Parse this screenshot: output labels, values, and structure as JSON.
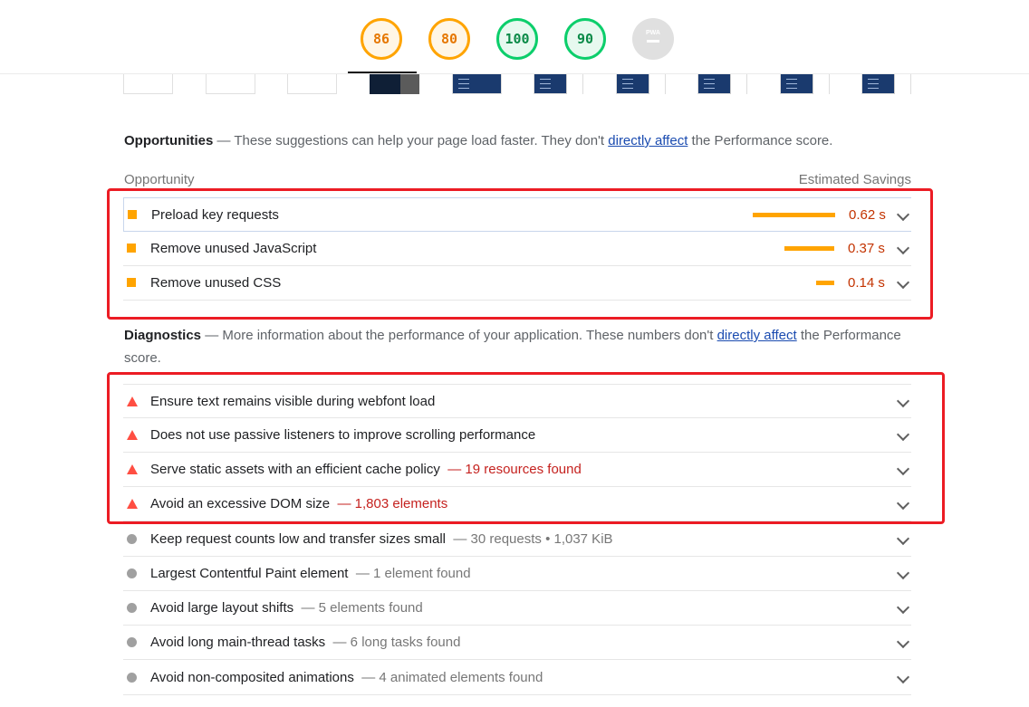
{
  "scores": [
    {
      "value": "86",
      "kind": "average"
    },
    {
      "value": "80",
      "kind": "average"
    },
    {
      "value": "100",
      "kind": "pass"
    },
    {
      "value": "90",
      "kind": "pass"
    }
  ],
  "pwa_label": "PWA",
  "opportunities": {
    "heading": "Opportunities",
    "desc_before": " — These suggestions can help your page load faster. They don't ",
    "link": "directly affect",
    "desc_after": " the Performance score.",
    "col_left": "Opportunity",
    "col_right": "Estimated Savings",
    "items": [
      {
        "title": "Preload key requests",
        "savings": "0.62 s",
        "fraction": 1.0
      },
      {
        "title": "Remove unused JavaScript",
        "savings": "0.37 s",
        "fraction": 0.6
      },
      {
        "title": "Remove unused CSS",
        "savings": "0.14 s",
        "fraction": 0.22
      }
    ]
  },
  "diagnostics": {
    "heading": "Diagnostics",
    "desc_before": " — More information about the performance of your application. These numbers don't ",
    "link": "directly affect",
    "desc_after": " the Performance score.",
    "items": [
      {
        "title": "Ensure text remains visible during webfont load",
        "display": "",
        "status": "fail"
      },
      {
        "title": "Does not use passive listeners to improve scrolling performance",
        "display": "",
        "status": "fail"
      },
      {
        "title": "Serve static assets with an efficient cache policy",
        "display": "— 19 resources found",
        "status": "fail"
      },
      {
        "title": "Avoid an excessive DOM size",
        "display": "— 1,803 elements",
        "status": "fail"
      },
      {
        "title": "Keep request counts low and transfer sizes small",
        "display": "— 30 requests • 1,037 KiB",
        "status": "info"
      },
      {
        "title": "Largest Contentful Paint element",
        "display": "— 1 element found",
        "status": "info"
      },
      {
        "title": "Avoid large layout shifts",
        "display": "— 5 elements found",
        "status": "info"
      },
      {
        "title": "Avoid long main-thread tasks",
        "display": "— 6 long tasks found",
        "status": "info"
      },
      {
        "title": "Avoid non-composited animations",
        "display": "— 4 animated elements found",
        "status": "info"
      }
    ]
  },
  "colors": {
    "average": "#ffa400",
    "pass": "#0cce6b",
    "fail": "#ff4e42",
    "highlight": "#ec1c24"
  }
}
